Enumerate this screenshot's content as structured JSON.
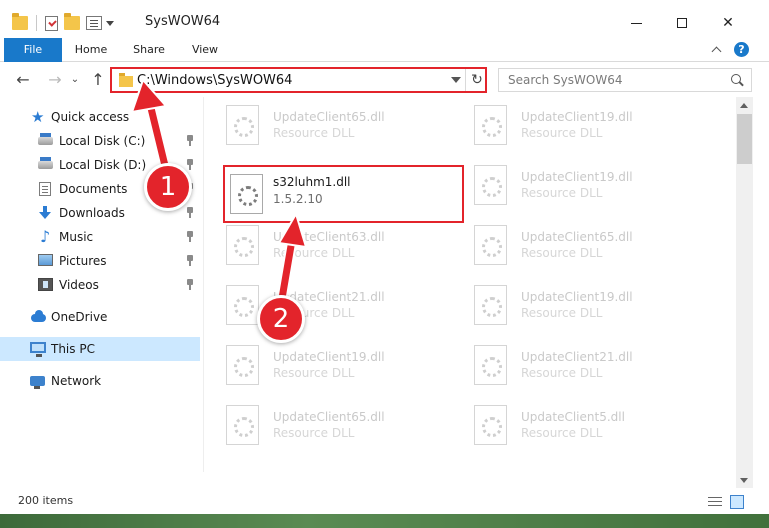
{
  "window": {
    "title": "SysWOW64",
    "minimize_glyph": "",
    "close_glyph": "✕"
  },
  "ribbon": {
    "tabs": [
      "File",
      "Home",
      "Share",
      "View"
    ],
    "help_glyph": "?"
  },
  "nav": {
    "back_glyph": "←",
    "forward_glyph": "→",
    "recent_glyph": "⌄",
    "up_glyph": "↑",
    "address_path": "C:\\Windows\\SysWOW64",
    "refresh_glyph": "↻",
    "search_placeholder": "Search SysWOW64"
  },
  "sidebar": {
    "items": [
      {
        "label": "Quick access",
        "icon": "star-icon",
        "pinned": false
      },
      {
        "label": "Local Disk (C:)",
        "icon": "hard-drive-icon",
        "pinned": true
      },
      {
        "label": "Local Disk (D:)",
        "icon": "hard-drive-icon",
        "pinned": true
      },
      {
        "label": "Documents",
        "icon": "documents-icon",
        "pinned": true
      },
      {
        "label": "Downloads",
        "icon": "download-icon",
        "pinned": true
      },
      {
        "label": "Music",
        "icon": "music-icon",
        "pinned": true
      },
      {
        "label": "Pictures",
        "icon": "pictures-icon",
        "pinned": true
      },
      {
        "label": "Videos",
        "icon": "videos-icon",
        "pinned": true
      },
      {
        "label": "OneDrive",
        "icon": "onedrive-icon",
        "pinned": false
      },
      {
        "label": "This PC",
        "icon": "computer-icon",
        "pinned": false,
        "selected": true
      },
      {
        "label": "Network",
        "icon": "network-icon",
        "pinned": false
      }
    ]
  },
  "files": {
    "highlighted": {
      "name": "s32luhm1.dll",
      "detail": "1.5.2.10"
    },
    "items": [
      {
        "name": "UpdateClient65.dll",
        "type": "Resource DLL"
      },
      {
        "name": "UpdateClient19.dll",
        "type": "Resource DLL"
      },
      {
        "name": "UpdateClient19.dll",
        "type": "Resource DLL"
      },
      {
        "name": "UpdateClient63.dll",
        "type": "Resource DLL"
      },
      {
        "name": "UpdateClient65.dll",
        "type": "Resource DLL"
      },
      {
        "name": "UpdateClient21.dll",
        "type": "Resource DLL"
      },
      {
        "name": "UpdateClient19.dll",
        "type": "Resource DLL"
      },
      {
        "name": "UpdateClient19.dll",
        "type": "Resource DLL"
      },
      {
        "name": "UpdateClient21.dll",
        "type": "Resource DLL"
      },
      {
        "name": "UpdateClient65.dll",
        "type": "Resource DLL"
      },
      {
        "name": "UpdateClient5.dll",
        "type": "Resource DLL"
      }
    ]
  },
  "status": {
    "item_count": "200 items"
  },
  "annotations": {
    "step1": "1",
    "step2": "2",
    "accent_color": "#e3242b"
  }
}
